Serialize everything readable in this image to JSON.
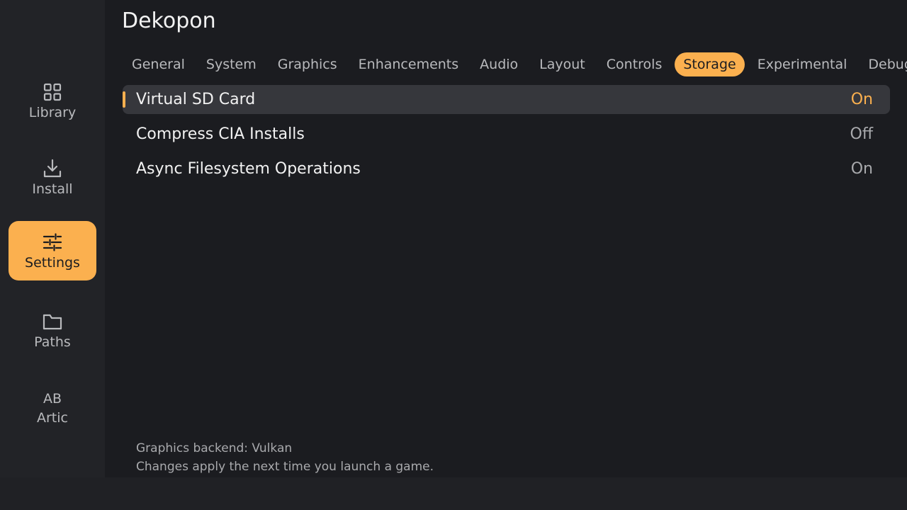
{
  "app": {
    "title": "Dekopon"
  },
  "accent_color": "#fbb04f",
  "sidebar": {
    "items": [
      {
        "label": "Library",
        "icon": "grid-icon",
        "active": false
      },
      {
        "label": "Install",
        "icon": "download-icon",
        "active": false
      },
      {
        "label": "Settings",
        "icon": "sliders-icon",
        "active": true
      },
      {
        "label": "Paths",
        "icon": "folder-icon",
        "active": false
      },
      {
        "label": "Artic",
        "icon_text": "AB",
        "active": false
      }
    ]
  },
  "tabs": [
    {
      "label": "General"
    },
    {
      "label": "System"
    },
    {
      "label": "Graphics"
    },
    {
      "label": "Enhancements"
    },
    {
      "label": "Audio"
    },
    {
      "label": "Layout"
    },
    {
      "label": "Controls"
    },
    {
      "label": "Storage",
      "active": true
    },
    {
      "label": "Experimental"
    },
    {
      "label": "Debug"
    }
  ],
  "settings": [
    {
      "name": "Virtual SD Card",
      "value": "On",
      "selected": true
    },
    {
      "name": "Compress CIA Installs",
      "value": "Off",
      "selected": false
    },
    {
      "name": "Async Filesystem Operations",
      "value": "On",
      "selected": false
    }
  ],
  "footer": {
    "backend": "Graphics backend: Vulkan",
    "note": "Changes apply the next time you launch a game."
  }
}
